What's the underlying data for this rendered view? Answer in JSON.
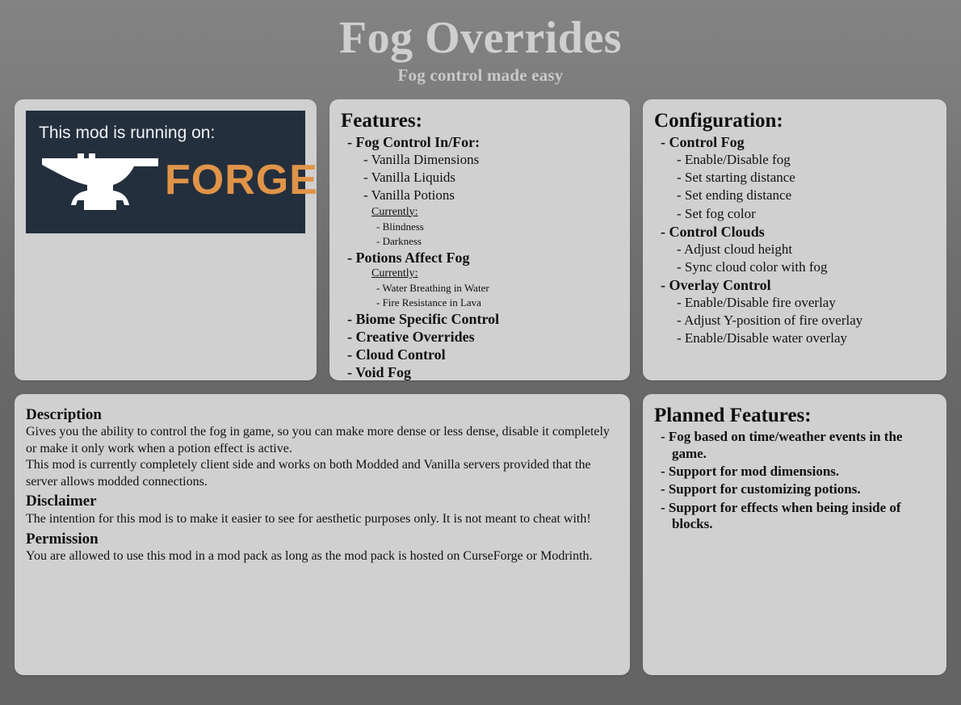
{
  "header": {
    "title": "Fog Overrides",
    "subtitle": "Fog control made easy"
  },
  "forge_card": {
    "caption": "This mod is running on:",
    "logo_word": "FORGE",
    "badge_bg": "#242f3d",
    "accent": "#e09448",
    "icon": "anvil-icon"
  },
  "features_card": {
    "heading": "Features:",
    "items": {
      "fog_control": "- Fog Control In/For:",
      "vanilla_dimensions": "- Vanilla Dimensions",
      "vanilla_liquids": "- Vanilla Liquids",
      "vanilla_potions": "- Vanilla Potions",
      "currently_1": "Currently:",
      "blindness": "- Blindness",
      "darkness": "- Darkness",
      "potions_affect_fog": "- Potions Affect Fog",
      "currently_2": "Currently:",
      "water_breathing": "- Water Breathing in Water",
      "fire_resistance": "- Fire Resistance in Lava",
      "biome_specific": "- Biome Specific Control",
      "creative_overrides": "- Creative Overrides",
      "cloud_control": "- Cloud Control",
      "void_fog": "- Void Fog"
    }
  },
  "config_card": {
    "heading": "Configuration:",
    "items": {
      "control_fog": "- Control Fog",
      "enable_disable_fog": "- Enable/Disable fog",
      "set_start_distance": "- Set starting distance",
      "set_end_distance": "- Set ending distance",
      "set_fog_color": "- Set fog color",
      "control_clouds": "- Control Clouds",
      "adjust_cloud_height": "- Adjust cloud height",
      "sync_cloud_color": "- Sync cloud color with fog",
      "overlay_control": "- Overlay Control",
      "enable_disable_fire_overlay": "- Enable/Disable fire overlay",
      "adjust_y_fire_overlay": "- Adjust Y-position of fire overlay",
      "enable_disable_water_overlay": "- Enable/Disable water overlay"
    }
  },
  "description_card": {
    "description_heading": "Description",
    "description_p1": "Gives you the ability to control the fog in game, so you can make more dense or less dense, disable it completely or make it only work when a potion effect is active.",
    "description_p2": "This mod is currently completely client side and works on both Modded and Vanilla servers provided that the server allows modded connections.",
    "disclaimer_heading": "Disclaimer",
    "disclaimer_body": "The intention for this mod is to make it easier to see for aesthetic purposes only. It is not meant to cheat with!",
    "permission_heading": "Permission",
    "permission_body": "You are allowed to use this mod in a mod pack as long as the mod pack is hosted on CurseForge or Modrinth."
  },
  "planned_card": {
    "heading": "Planned Features:",
    "items": {
      "time_weather": "- Fog based on time/weather events in the game.",
      "mod_dimensions": "- Support for mod dimensions.",
      "customizing_potions": "- Support for customizing potions.",
      "inside_blocks": "- Support for effects when being inside of blocks."
    }
  }
}
